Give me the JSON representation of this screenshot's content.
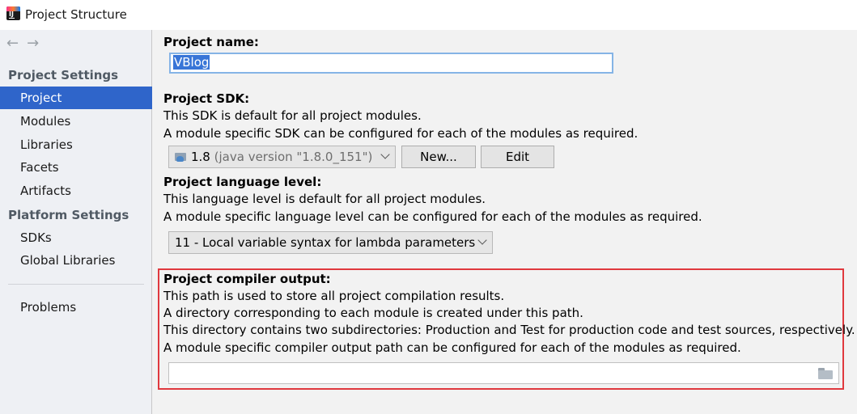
{
  "window": {
    "title": "Project Structure",
    "app_icon_text": "IJ"
  },
  "sidebar": {
    "back_arrow": "←",
    "forward_arrow": "→",
    "project_settings_header": "Project Settings",
    "project_settings_items": [
      "Project",
      "Modules",
      "Libraries",
      "Facets",
      "Artifacts"
    ],
    "platform_settings_header": "Platform Settings",
    "platform_settings_items": [
      "SDKs",
      "Global Libraries"
    ],
    "problems": "Problems",
    "selected": "Project"
  },
  "project_name": {
    "label": "Project name:",
    "value": "VBlog"
  },
  "project_sdk": {
    "label": "Project SDK:",
    "desc1": "This SDK is default for all project modules.",
    "desc2": "A module specific SDK can be configured for each of the modules as required.",
    "selected_version": "1.8",
    "selected_detail": "(java version \"1.8.0_151\")",
    "new_button": "New...",
    "edit_button": "Edit"
  },
  "language_level": {
    "label": "Project language level:",
    "desc1": "This language level is default for all project modules.",
    "desc2": "A module specific language level can be configured for each of the modules as required.",
    "selected": "11 - Local variable syntax for lambda parameters"
  },
  "compiler_output": {
    "label": "Project compiler output:",
    "desc1": "This path is used to store all project compilation results.",
    "desc2": "A directory corresponding to each module is created under this path.",
    "desc3": "This directory contains two subdirectories: Production and Test for production code and test sources, respectively.",
    "desc4": "A module specific compiler output path can be configured for each of the modules as required.",
    "path_value": "",
    "highlight_color": "#e0393e"
  },
  "colors": {
    "selection": "#2f65ca",
    "input_focus": "#85b4e6"
  },
  "icons": [
    "app-icon",
    "back-arrow-icon",
    "forward-arrow-icon",
    "sdk-icon",
    "chevron-down-icon",
    "folder-icon"
  ]
}
